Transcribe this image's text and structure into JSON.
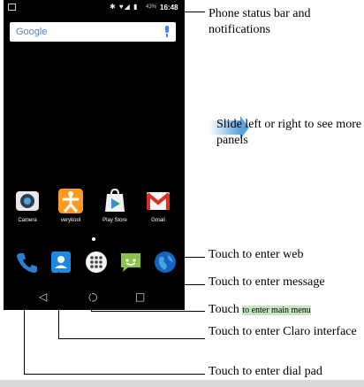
{
  "status_bar": {
    "battery": "43%",
    "time": "16:48",
    "symbols": "✱ ♥◢ ▮"
  },
  "search": {
    "logo_text": "Google"
  },
  "apps": [
    {
      "label": "Camera",
      "icon": "camera-icon"
    },
    {
      "label": "verykool",
      "icon": "verykool-icon"
    },
    {
      "label": "Play Store",
      "icon": "play-store-icon"
    },
    {
      "label": "Gmail",
      "icon": "gmail-icon"
    }
  ],
  "nav": {
    "back": "◁",
    "home": "○",
    "recent": "□"
  },
  "annotations": {
    "status_bar": "Phone status bar and notifications",
    "slide_panels": "Slide left or right to see more panels",
    "web": "Touch to enter web",
    "message": "Touch to enter message",
    "main_menu_prefix": "Touch",
    "main_menu_suffix": "to enter main menu",
    "claro": "Touch to enter Claro interface",
    "dial": "Touch to enter dial pad"
  },
  "colors": {
    "phone_bg": "#000000",
    "arrow_blue": "#5aa4de",
    "highlight_green": "#c6e6c0",
    "dial_blue": "#2a7fd0",
    "claro_blue": "#1e88e5",
    "message_green": "#8bc34a",
    "verykool_orange": "#ff9a1f",
    "gmail_red": "#d93025"
  }
}
